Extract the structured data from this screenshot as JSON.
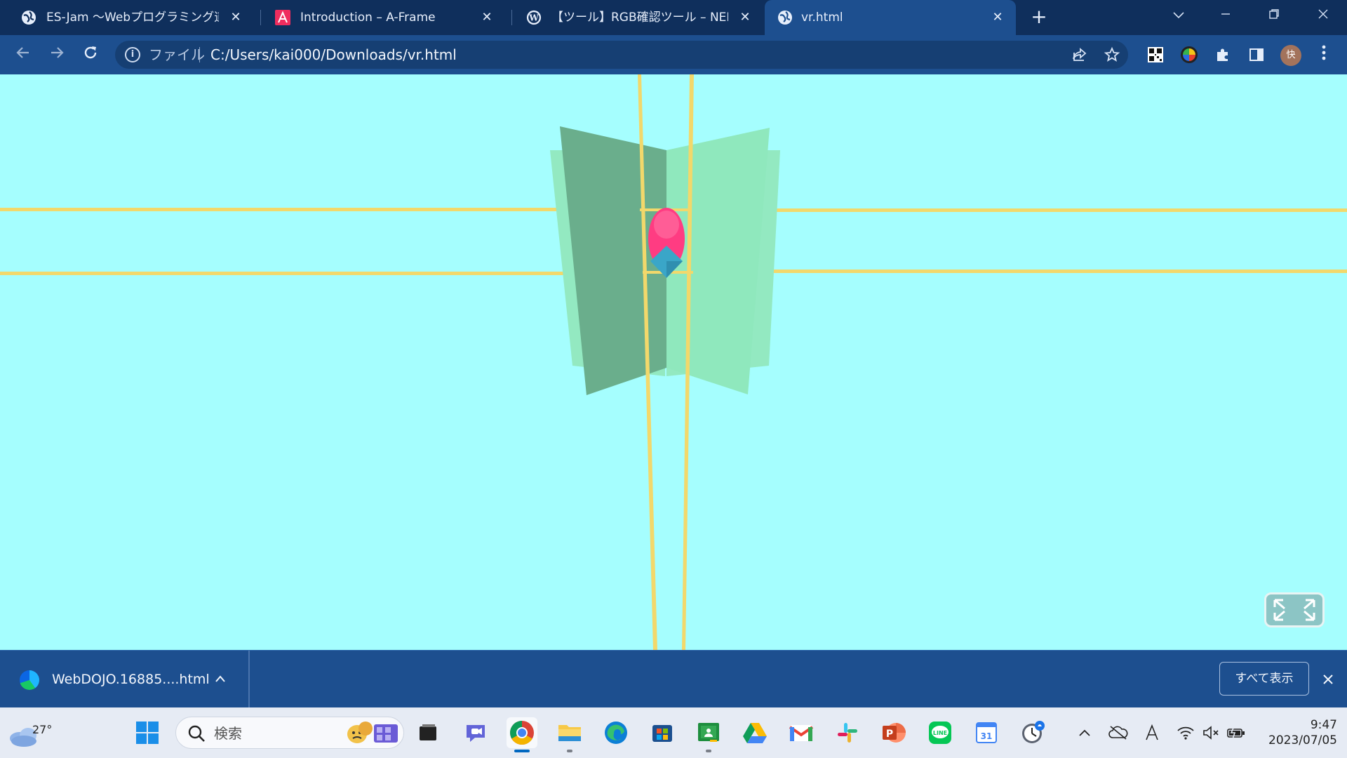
{
  "browser": {
    "tabs": [
      {
        "title": "ES-Jam 〜Webプログラミング道場〜",
        "icon": "globe-icon",
        "active": false
      },
      {
        "title": "Introduction – A-Frame",
        "icon": "aframe-icon",
        "active": false
      },
      {
        "title": "【ツール】RGB確認ツール – NEMOT's",
        "icon": "wordpress-icon",
        "active": false
      },
      {
        "title": "vr.html",
        "icon": "globe-icon",
        "active": true
      }
    ],
    "close_glyph": "✕",
    "new_tab_glyph": "+",
    "omnibox": {
      "scheme_label": "ファイル",
      "url": "C:/Users/kai000/Downloads/vr.html"
    },
    "profile_initial": "快"
  },
  "scene": {
    "sky_color": "#a5fefe",
    "panel_colors": [
      "#93e9c1",
      "#6aae8c",
      "#8fe8bd"
    ],
    "rod_color": "#f2d86b",
    "sphere_color": "#ff3c82",
    "diamond_color": "#3aa6c8"
  },
  "download_bar": {
    "file_name": "WebDOJO.16885....html",
    "show_all_label": "すべて表示"
  },
  "taskbar": {
    "weather_temp": "27°",
    "search_placeholder": "検索",
    "clock_time": "9:47",
    "clock_date": "2023/07/05",
    "pinned_apps": [
      "windows-start",
      "search",
      "file-viewer",
      "teams",
      "chrome",
      "file-explorer",
      "edge",
      "store",
      "classroom",
      "drive",
      "gmail",
      "slack",
      "powerpoint",
      "line",
      "calendar",
      "clock"
    ],
    "calendar_day": "31"
  }
}
